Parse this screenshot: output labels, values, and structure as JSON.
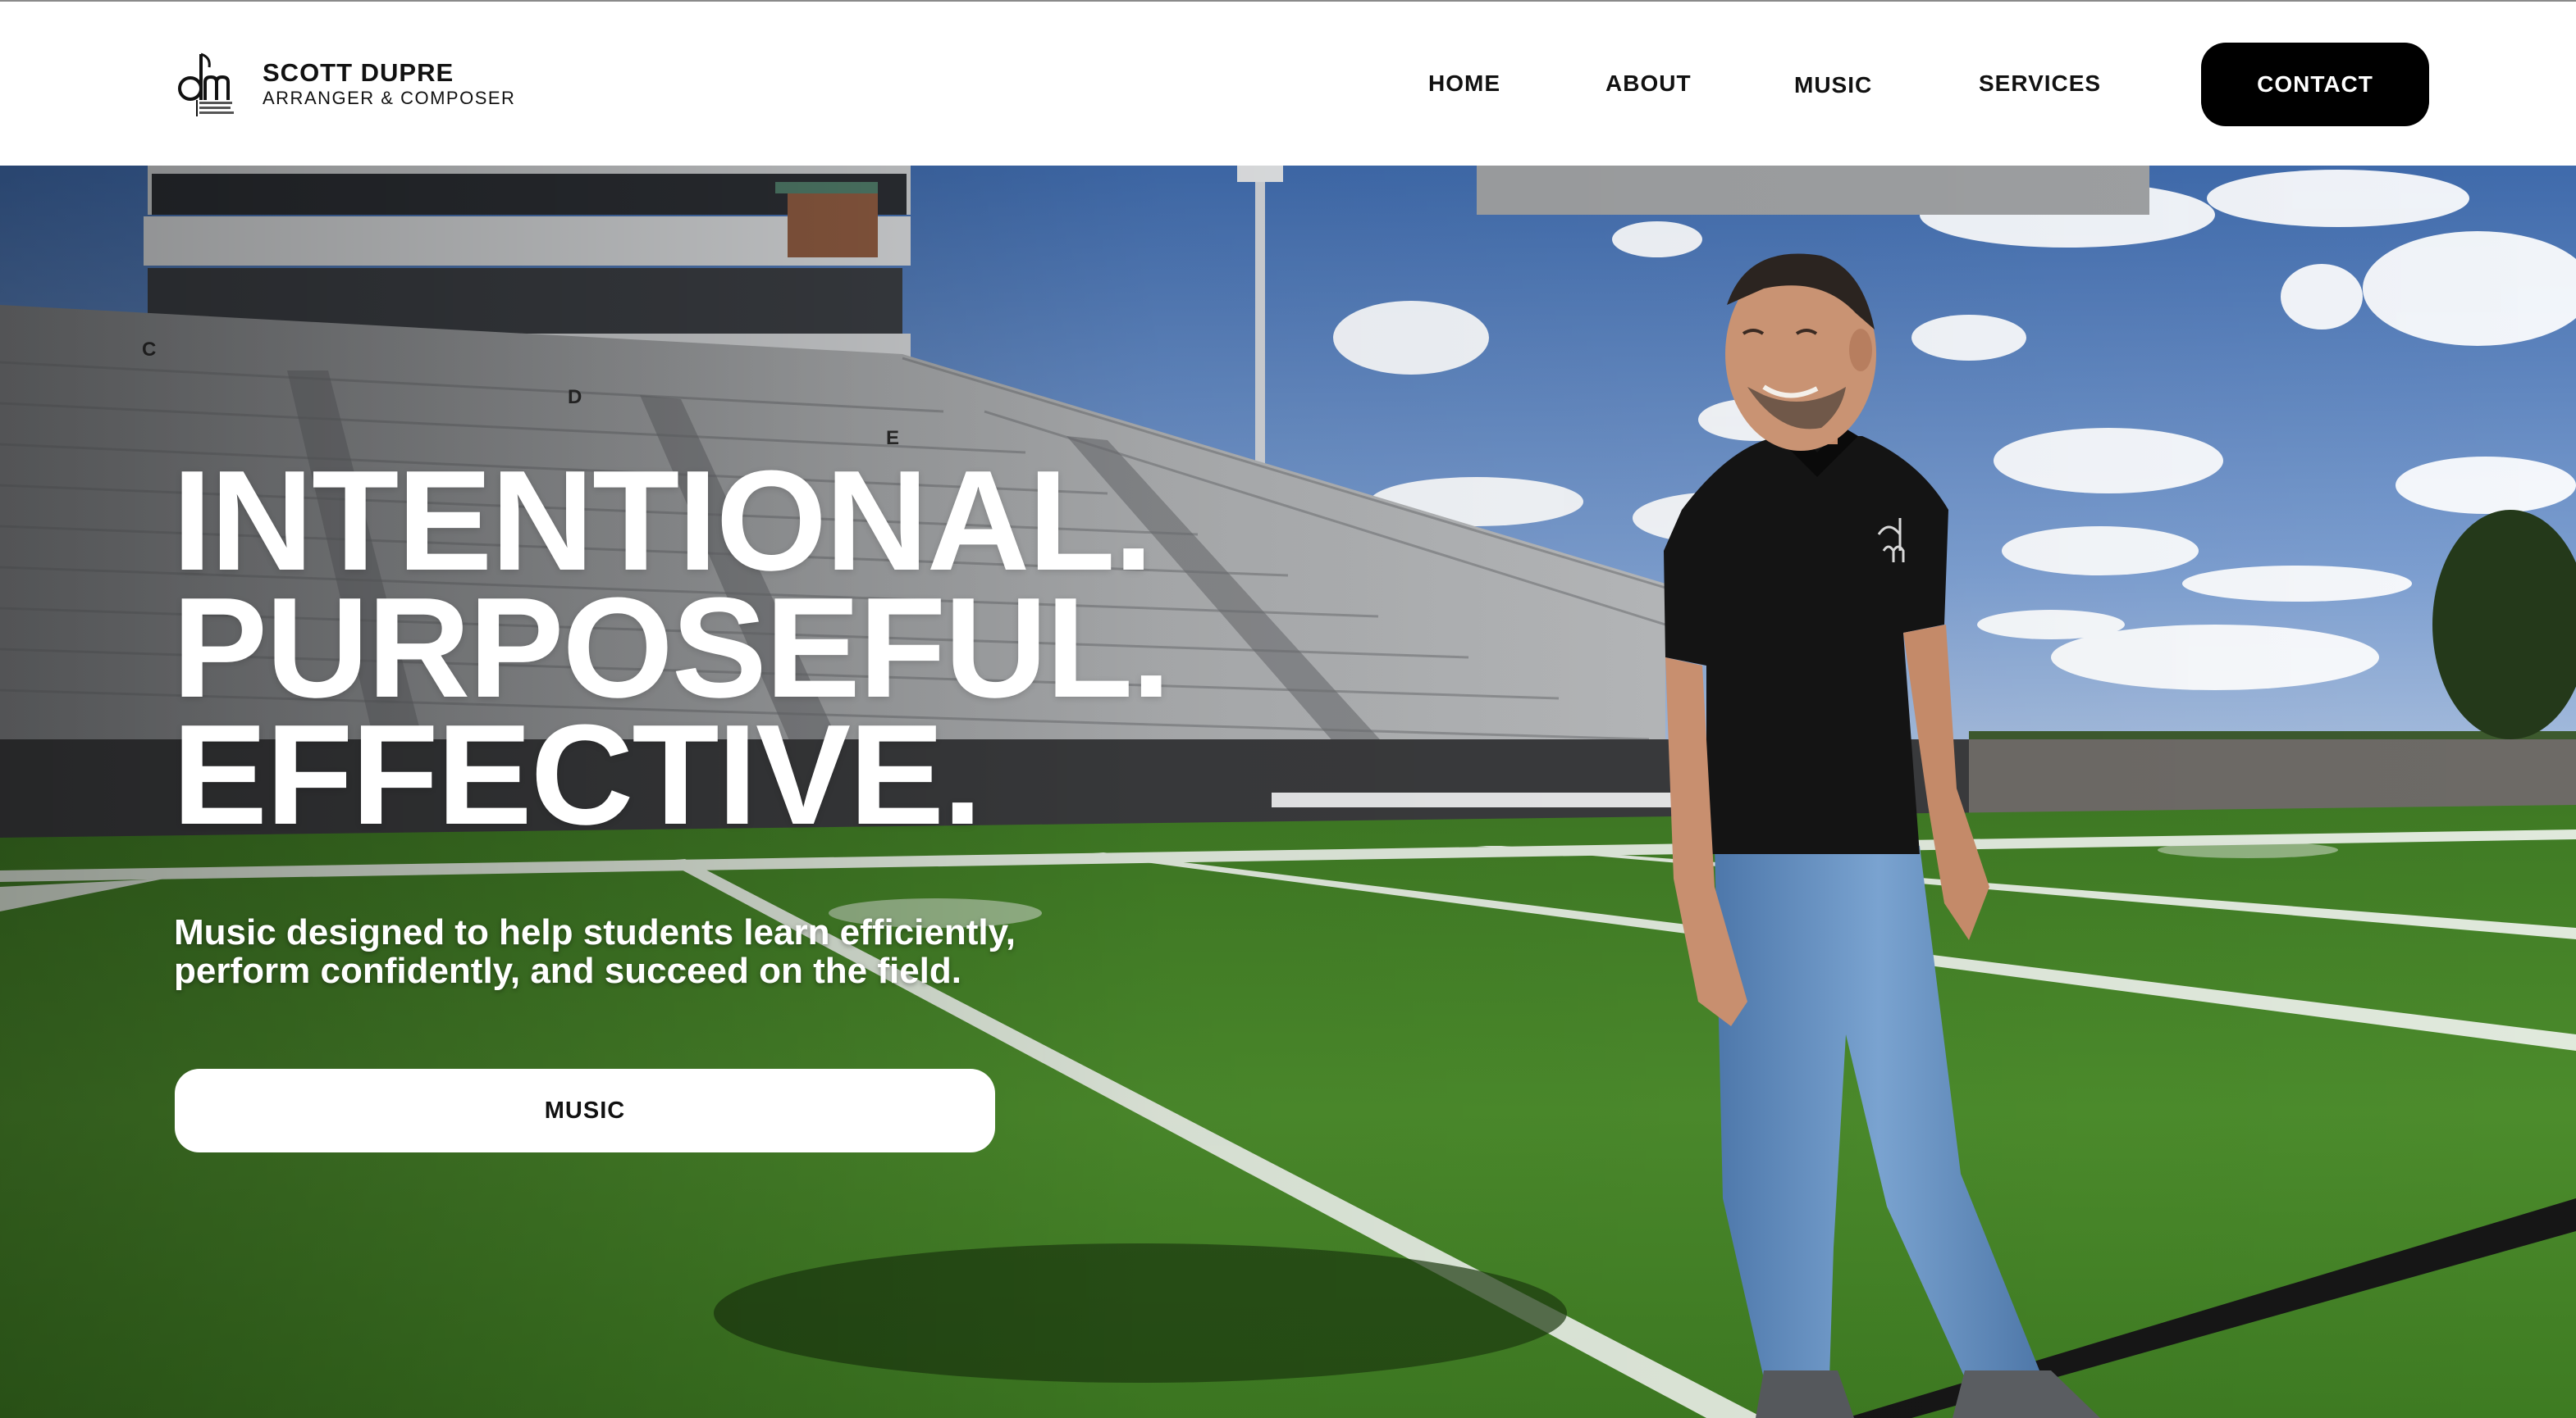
{
  "brand": {
    "name": "SCOTT DUPRE",
    "role": "ARRANGER & COMPOSER",
    "logo_icon": "dm-monogram-logo"
  },
  "nav": {
    "items": [
      {
        "label": "HOME"
      },
      {
        "label": "ABOUT"
      },
      {
        "label": "MUSIC"
      },
      {
        "label": "SERVICES"
      }
    ],
    "contact_label": "CONTACT"
  },
  "hero": {
    "headline": [
      "INTENTIONAL.",
      "PURPOSEFUL.",
      "EFFECTIVE."
    ],
    "subcopy": "Music designed to help students learn efficiently, perform confidently, and succeed on the field.",
    "cta_label": "MUSIC",
    "section_letters": [
      "C",
      "D",
      "E"
    ],
    "colors": {
      "sky": "#5f86c2",
      "turf": "#4f8a2a",
      "stands": "#9a9c9e",
      "shirt": "#151515",
      "jeans": "#5f89bd"
    }
  }
}
